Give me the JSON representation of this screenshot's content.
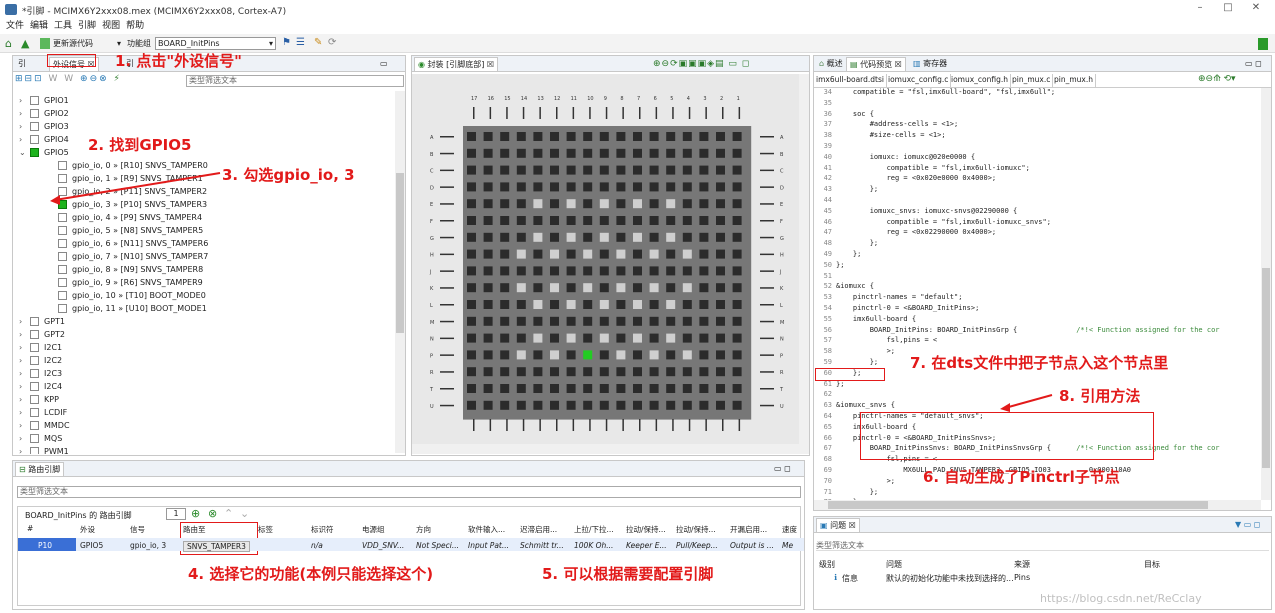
{
  "window": {
    "title": "*引脚 - MCIMX6Y2xxx08.mex (MCIMX6Y2xxx08, Cortex-A7)",
    "min": "–",
    "max": "□",
    "close": "✕"
  },
  "menu": [
    "文件",
    "编辑",
    "工具",
    "引脚",
    "视图",
    "帮助"
  ],
  "toolbar": {
    "update_code": "更新源代码",
    "func_group_label": "功能组",
    "func_group_value": "BOARD_InitPins"
  },
  "left_panel": {
    "tabs": [
      "引",
      "外设信号",
      "引"
    ],
    "filter_placeholder": "类型筛选文本",
    "items": [
      {
        "label": "GPIO1",
        "checked": false,
        "indent": 0
      },
      {
        "label": "GPIO2",
        "checked": false,
        "indent": 0
      },
      {
        "label": "GPIO3",
        "checked": false,
        "indent": 0
      },
      {
        "label": "GPIO4",
        "checked": false,
        "indent": 0
      },
      {
        "label": "GPIO5",
        "checked": true,
        "indent": 0
      },
      {
        "label": "gpio_io, 0 » [R10] SNVS_TAMPER0",
        "checked": false,
        "indent": 1
      },
      {
        "label": "gpio_io, 1 » [R9] SNVS_TAMPER1",
        "checked": false,
        "indent": 1
      },
      {
        "label": "gpio_io, 2 » [P11] SNVS_TAMPER2",
        "checked": false,
        "indent": 1
      },
      {
        "label": "gpio_io, 3 » [P10] SNVS_TAMPER3",
        "checked": true,
        "indent": 1
      },
      {
        "label": "gpio_io, 4 » [P9] SNVS_TAMPER4",
        "checked": false,
        "indent": 1
      },
      {
        "label": "gpio_io, 5 » [N8] SNVS_TAMPER5",
        "checked": false,
        "indent": 1
      },
      {
        "label": "gpio_io, 6 » [N11] SNVS_TAMPER6",
        "checked": false,
        "indent": 1
      },
      {
        "label": "gpio_io, 7 » [N10] SNVS_TAMPER7",
        "checked": false,
        "indent": 1
      },
      {
        "label": "gpio_io, 8 » [N9] SNVS_TAMPER8",
        "checked": false,
        "indent": 1
      },
      {
        "label": "gpio_io, 9 » [R6] SNVS_TAMPER9",
        "checked": false,
        "indent": 1
      },
      {
        "label": "gpio_io, 10 » [T10] BOOT_MODE0",
        "checked": false,
        "indent": 1
      },
      {
        "label": "gpio_io, 11 » [U10] BOOT_MODE1",
        "checked": false,
        "indent": 1
      },
      {
        "label": "GPT1",
        "checked": false,
        "indent": 0
      },
      {
        "label": "GPT2",
        "checked": false,
        "indent": 0
      },
      {
        "label": "I2C1",
        "checked": false,
        "indent": 0
      },
      {
        "label": "I2C2",
        "checked": false,
        "indent": 0
      },
      {
        "label": "I2C3",
        "checked": false,
        "indent": 0
      },
      {
        "label": "I2C4",
        "checked": false,
        "indent": 0
      },
      {
        "label": "KPP",
        "checked": false,
        "indent": 0
      },
      {
        "label": "LCDIF",
        "checked": false,
        "indent": 0
      },
      {
        "label": "MMDC",
        "checked": false,
        "indent": 0
      },
      {
        "label": "MQS",
        "checked": false,
        "indent": 0
      },
      {
        "label": "PWM1",
        "checked": false,
        "indent": 0
      }
    ]
  },
  "package_panel": {
    "tab": "封装 [引脚底部]",
    "cols": [
      "17",
      "16",
      "15",
      "14",
      "13",
      "12",
      "11",
      "10",
      "9",
      "8",
      "7",
      "6",
      "5",
      "4",
      "3",
      "2",
      "1"
    ],
    "rows": [
      "A",
      "B",
      "C",
      "D",
      "E",
      "F",
      "G",
      "H",
      "J",
      "K",
      "L",
      "M",
      "N",
      "P",
      "R",
      "T",
      "U"
    ]
  },
  "code_panel": {
    "tabs": [
      "概述",
      "代码预览",
      "寄存器"
    ],
    "files": [
      "imx6ull-board.dtsi",
      "iomuxc_config.c",
      "iomux_config.h",
      "pin_mux.c",
      "pin_mux.h"
    ],
    "lines": [
      {
        "n": "34",
        "t": "    compatible = \"fsl,imx6ull-board\", \"fsl,imx6ull\";"
      },
      {
        "n": "35",
        "t": ""
      },
      {
        "n": "36",
        "t": "    soc {"
      },
      {
        "n": "37",
        "t": "        #address-cells = <1>;"
      },
      {
        "n": "38",
        "t": "        #size-cells = <1>;"
      },
      {
        "n": "39",
        "t": ""
      },
      {
        "n": "40",
        "t": "        iomuxc: iomuxc@020e0000 {"
      },
      {
        "n": "41",
        "t": "            compatible = \"fsl,imx6ull-iomuxc\";"
      },
      {
        "n": "42",
        "t": "            reg = <0x020e0000 0x4000>;"
      },
      {
        "n": "43",
        "t": "        };"
      },
      {
        "n": "44",
        "t": ""
      },
      {
        "n": "45",
        "t": "        iomuxc_snvs: iomuxc-snvs@02290000 {"
      },
      {
        "n": "46",
        "t": "            compatible = \"fsl,imx6ull-iomuxc_snvs\";"
      },
      {
        "n": "47",
        "t": "            reg = <0x02290000 0x4000>;"
      },
      {
        "n": "48",
        "t": "        };"
      },
      {
        "n": "49",
        "t": "    };"
      },
      {
        "n": "50",
        "t": "};"
      },
      {
        "n": "51",
        "t": ""
      },
      {
        "n": "52",
        "t": "&iomuxc {"
      },
      {
        "n": "53",
        "t": "    pinctrl-names = \"default\";"
      },
      {
        "n": "54",
        "t": "    pinctrl-0 = <&BOARD_InitPins>;"
      },
      {
        "n": "55",
        "t": "    imx6ull-board {"
      },
      {
        "n": "56",
        "t": "        BOARD_InitPins: BOARD_InitPinsGrp {              /*!< Function assigned for the cor"
      },
      {
        "n": "57",
        "t": "            fsl,pins = <"
      },
      {
        "n": "58",
        "t": "            >;"
      },
      {
        "n": "59",
        "t": "        };"
      },
      {
        "n": "60",
        "t": "    };"
      },
      {
        "n": "61",
        "t": "};"
      },
      {
        "n": "62",
        "t": ""
      },
      {
        "n": "63",
        "t": "&iomuxc_snvs {"
      },
      {
        "n": "64",
        "t": "    pinctrl-names = \"default_snvs\";"
      },
      {
        "n": "65",
        "t": "    imx6ull-board {"
      },
      {
        "n": "66",
        "t": "    pinctrl-0 = <&BOARD_InitPinsSnvs>;"
      },
      {
        "n": "67",
        "t": "        BOARD_InitPinsSnvs: BOARD_InitPinsSnvsGrp {      /*!< Function assigned for the cor"
      },
      {
        "n": "68",
        "t": "            fsl,pins = <"
      },
      {
        "n": "69",
        "t": "                MX6ULL_PAD_SNVS_TAMPER3__GPIO5_IO03         0x000110A0"
      },
      {
        "n": "70",
        "t": "            >;"
      },
      {
        "n": "71",
        "t": "        };"
      },
      {
        "n": "72",
        "t": "    };"
      },
      {
        "n": "73",
        "t": "};"
      },
      {
        "n": "74",
        "t": ""
      },
      {
        "n": "75",
        "t": ""
      }
    ]
  },
  "route_panel": {
    "tab": "路由引脚",
    "filter_placeholder": "类型筛选文本",
    "group_label": "BOARD_InitPins 的 路由引脚",
    "count": "1",
    "headers": [
      "#",
      "外设",
      "信号",
      "路由至",
      "标签",
      "标识符",
      "电源组",
      "方向",
      "软件输入...",
      "迟滞启用...",
      "上拉/下拉...",
      "拉动/保持...",
      "拉动/保持...",
      "开漏启用...",
      "速度"
    ],
    "row": [
      "P10",
      "GPIO5",
      "gpio_io, 3",
      "SNVS_TAMPER3",
      "",
      "n/a",
      "VDD_SNV...",
      "Not Speci...",
      "Input Pat...",
      "Schmitt tr...",
      "100K Oh...",
      "Keeper E...",
      "Pull/Keep...",
      "Output is ...",
      "Me"
    ]
  },
  "problems_panel": {
    "tab": "问题",
    "filter_placeholder": "类型筛选文本",
    "headers": [
      "级别",
      "问题",
      "来源",
      "目标"
    ],
    "row": {
      "level": "信息",
      "problem": "默认的初始化功能中未找到选择的...",
      "source": "Pins",
      "target": ""
    }
  },
  "annotations": {
    "a1": "1. 点击\"外设信号\"",
    "a2": "2. 找到GPIO5",
    "a3": "3. 勾选gpio_io, 3",
    "a4": "4. 选择它的功能(本例只能选择这个)",
    "a5": "5. 可以根据需要配置引脚",
    "a6": "6. 自动生成了Pinctrl子节点",
    "a7": "7. 在dts文件中把子节点入这个节点里",
    "a8": "8. 引用方法"
  },
  "watermark": "https://blog.csdn.net/ReCclay"
}
